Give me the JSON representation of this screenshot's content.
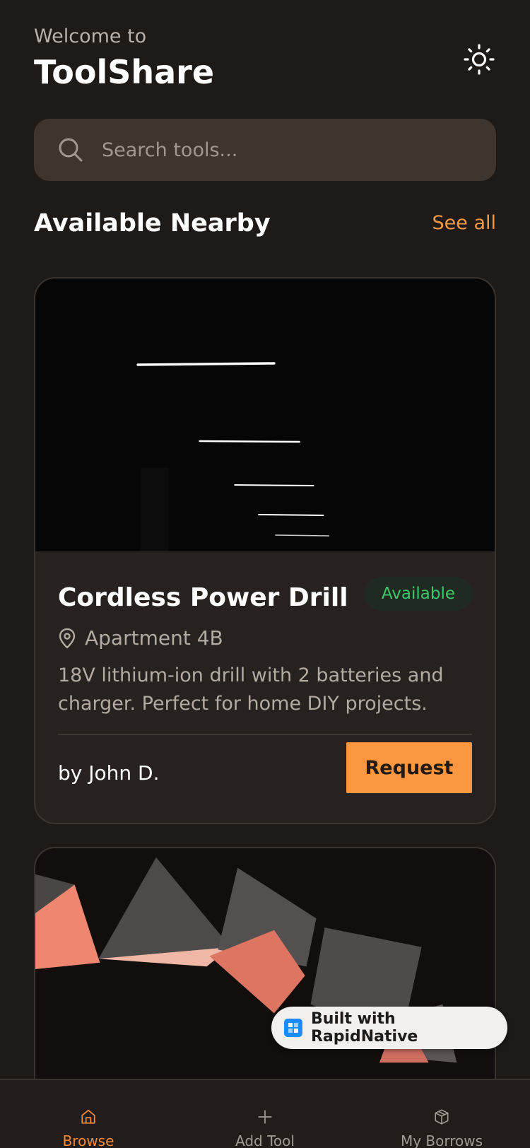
{
  "header": {
    "welcome": "Welcome to",
    "title": "ToolShare"
  },
  "search": {
    "placeholder": "Search tools..."
  },
  "section": {
    "title": "Available Nearby",
    "see_all": "See all"
  },
  "tools": [
    {
      "name": "Cordless Power Drill",
      "status": "Available",
      "location": "Apartment 4B",
      "description": "18V lithium-ion drill with 2 batteries and charger. Perfect for home DIY projects.",
      "owner": "by John D.",
      "action": "Request"
    }
  ],
  "badge": {
    "text": "Built with RapidNative"
  },
  "tabs": [
    {
      "label": "Browse",
      "icon": "home-icon",
      "active": true
    },
    {
      "label": "Add Tool",
      "icon": "plus-icon",
      "active": false
    },
    {
      "label": "My Borrows",
      "icon": "box-icon",
      "active": false
    }
  ],
  "colors": {
    "background": "#1e1a18",
    "accent": "#f59a45",
    "card": "#272220",
    "available": "#3fc66b"
  },
  "icons": {
    "theme_toggle": "sun-icon",
    "search": "search-icon",
    "location": "map-pin-icon"
  }
}
